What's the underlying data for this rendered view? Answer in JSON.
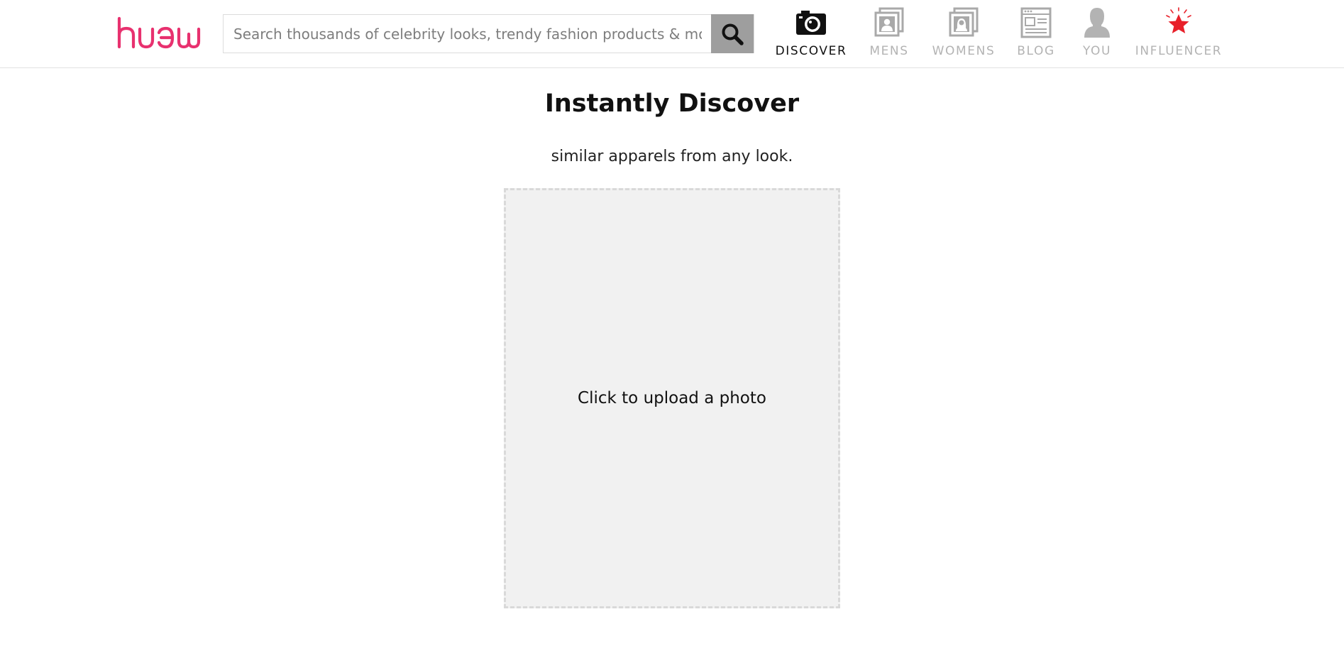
{
  "brand": {
    "logo_text": "huew",
    "accent_color": "#e8316f"
  },
  "search": {
    "placeholder": "Search thousands of celebrity looks, trendy fashion products & more..",
    "value": "",
    "button_icon": "search-icon"
  },
  "nav": {
    "items": [
      {
        "label": "DISCOVER",
        "icon": "camera-icon",
        "active": true
      },
      {
        "label": "MENS",
        "icon": "mens-photo-icon",
        "active": false
      },
      {
        "label": "WOMENS",
        "icon": "womens-photo-icon",
        "active": false
      },
      {
        "label": "BLOG",
        "icon": "blog-page-icon",
        "active": false
      },
      {
        "label": "YOU",
        "icon": "user-silhouette-icon",
        "active": false
      },
      {
        "label": "INFLUENCER",
        "icon": "star-icon",
        "active": false
      }
    ]
  },
  "main": {
    "title": "Instantly Discover",
    "subtitle": "similar apparels from any look.",
    "upload_label": "Click to upload a photo"
  },
  "colors": {
    "nav_inactive": "#b3b3b3",
    "nav_active": "#111111",
    "search_button": "#9e9e9e",
    "upload_bg": "#f1f1f1",
    "upload_border": "#d9d9d9",
    "star": "#e8202a"
  }
}
